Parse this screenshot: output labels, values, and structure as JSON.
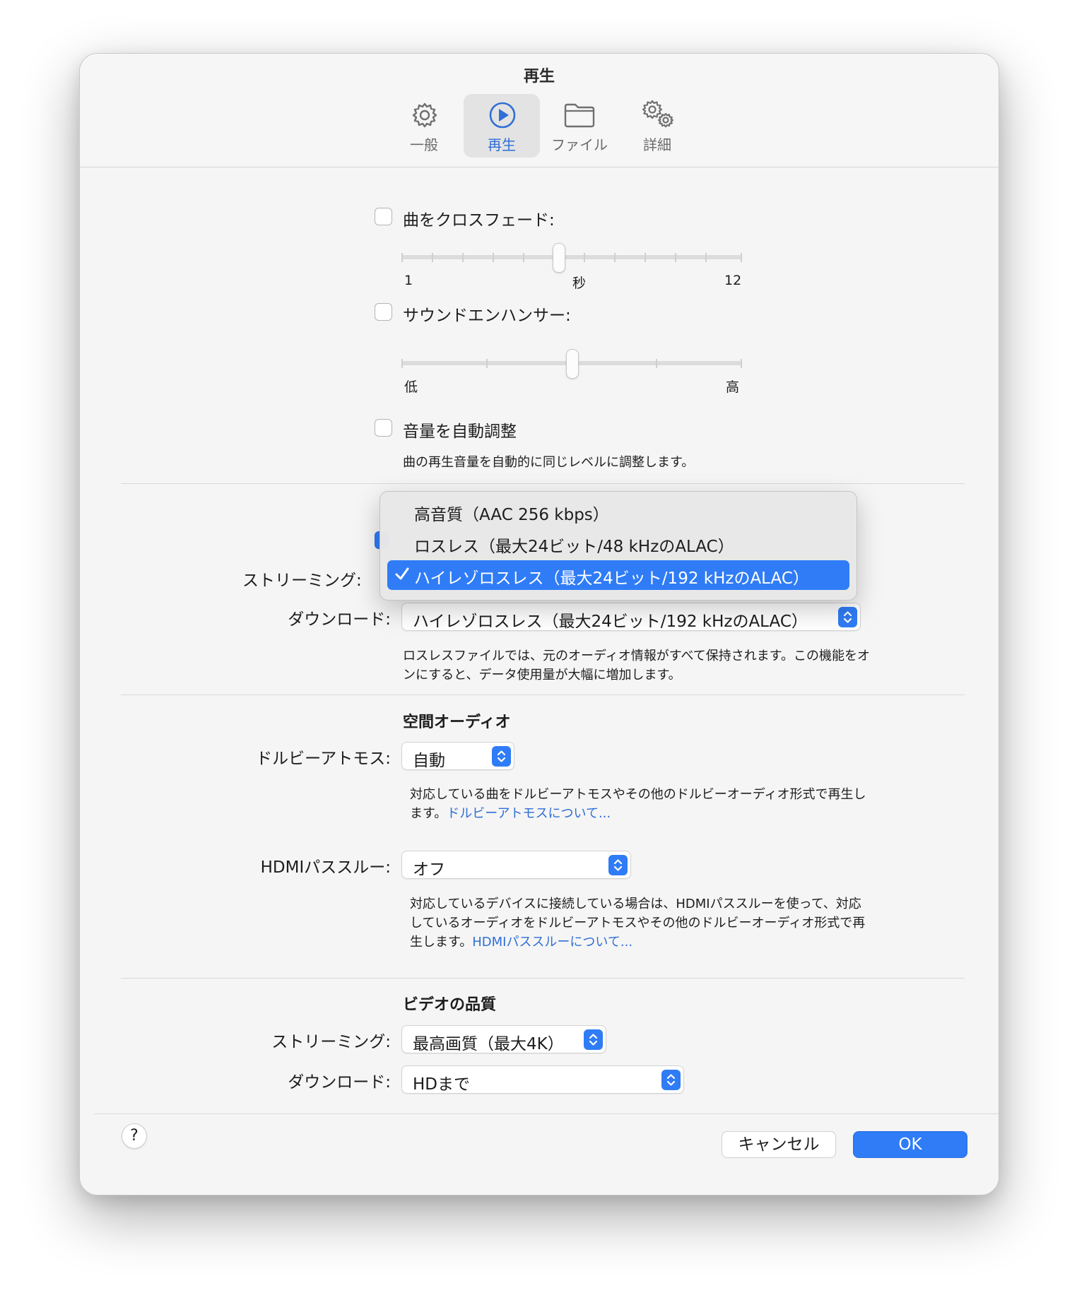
{
  "window": {
    "title": "再生"
  },
  "toolbar": {
    "tabs": [
      {
        "label": "一般",
        "icon": "gear-icon"
      },
      {
        "label": "再生",
        "icon": "play-circle-icon",
        "active": true
      },
      {
        "label": "ファイル",
        "icon": "folder-icon"
      },
      {
        "label": "詳細",
        "icon": "gears-icon"
      }
    ]
  },
  "crossfade": {
    "label": "曲をクロスフェード:",
    "checked": false,
    "min_label": "1",
    "unit_label": "秒",
    "max_label": "12",
    "value_seconds": 6
  },
  "sound_enhancer": {
    "label": "サウンドエンハンサー:",
    "checked": false,
    "low_label": "低",
    "high_label": "高",
    "level": 0.5
  },
  "sound_check": {
    "label": "音量を自動調整",
    "checked": false,
    "description": "曲の再生音量を自動的に同じレベルに調整します。"
  },
  "audio_quality": {
    "lossless_checked": true,
    "streaming_label": "ストリーミング:",
    "download_label": "ダウンロード:",
    "download_value": "ハイレゾロスレス（最大24ビット/192 kHzのALAC）",
    "description_line1": "ロスレスファイルでは、元のオーディオ情報がすべて保持されます。この機能をオ",
    "description_line2": "ンにすると、データ使用量が大幅に増加します。",
    "menu_options": [
      "高音質（AAC 256 kbps）",
      "ロスレス（最大24ビット/48 kHzのALAC）",
      "ハイレゾロスレス（最大24ビット/192 kHzのALAC）"
    ],
    "menu_selected_index": 2
  },
  "spatial_audio": {
    "heading": "空間オーディオ",
    "dolby_label": "ドルビーアトモス:",
    "dolby_value": "自動",
    "dolby_desc_line1": "対応している曲をドルビーアトモスやその他のドルビーオーディオ形式で再生し",
    "dolby_desc_line2_prefix": "ます。",
    "dolby_link": "ドルビーアトモスについて...",
    "hdmi_label": "HDMIパススルー:",
    "hdmi_value": "オフ",
    "hdmi_desc_line1": "対応しているデバイスに接続している場合は、HDMIパススルーを使って、対応",
    "hdmi_desc_line2": "しているオーディオをドルビーアトモスやその他のドルビーオーディオ形式で再",
    "hdmi_desc_line3_prefix": "生します。",
    "hdmi_link": "HDMIパススルーについて..."
  },
  "video_quality": {
    "heading": "ビデオの品質",
    "streaming_label": "ストリーミング:",
    "streaming_value": "最高画質（最大4K）",
    "download_label": "ダウンロード:",
    "download_value": "HDまで"
  },
  "footer": {
    "help_label": "?",
    "cancel_label": "キャンセル",
    "ok_label": "OK"
  },
  "colors": {
    "accent": "#2f7cf6",
    "link": "#2f6fd6"
  }
}
